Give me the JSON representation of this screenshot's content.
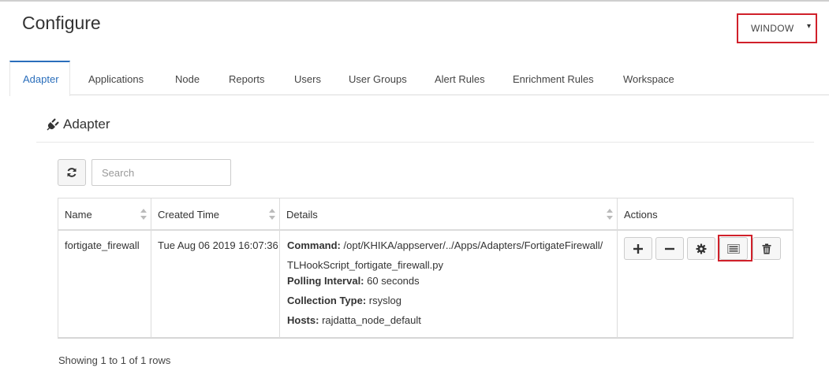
{
  "page": {
    "title": "Configure"
  },
  "window_select": {
    "value": "WINDOW",
    "caret": "▾"
  },
  "tabs": [
    {
      "label": "Adapter",
      "active": true
    },
    {
      "label": "Applications"
    },
    {
      "label": "Node"
    },
    {
      "label": "Reports"
    },
    {
      "label": "Users"
    },
    {
      "label": "User Groups"
    },
    {
      "label": "Alert Rules"
    },
    {
      "label": "Enrichment Rules"
    },
    {
      "label": "Workspace"
    }
  ],
  "section": {
    "title": "Adapter",
    "icon": "plug-icon"
  },
  "toolbar": {
    "refresh_icon": "refresh-icon",
    "search_placeholder": "Search"
  },
  "table": {
    "columns": [
      "Name",
      "Created Time",
      "Details",
      "Actions"
    ],
    "rows": [
      {
        "name": "fortigate_firewall",
        "created_time": "Tue Aug 06 2019 16:07:36",
        "details": {
          "command_label": "Command:",
          "command_line1": "/opt/KHIKA/appserver/../Apps/Adapters/FortigateFirewall/",
          "command_line2": "TLHookScript_fortigate_firewall.py",
          "polling_label": "Polling Interval:",
          "polling_value": "60 seconds",
          "collection_label": "Collection Type:",
          "collection_value": "rsyslog",
          "hosts_label": "Hosts:",
          "hosts_value": "rajdatta_node_default"
        },
        "actions": [
          "plus-icon",
          "minus-icon",
          "gear-icon",
          "list-icon",
          "trash-icon"
        ]
      }
    ]
  },
  "footer": {
    "text": "Showing 1 to 1 of 1 rows"
  },
  "colors": {
    "accent": "#2a6ebb",
    "highlight": "#d0202a",
    "border": "#dcdcdc"
  }
}
